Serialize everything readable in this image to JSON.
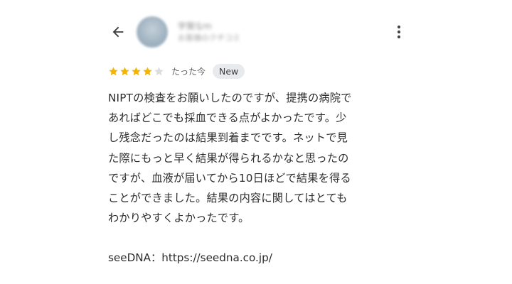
{
  "header": {
    "back_icon": "arrow-left-icon",
    "reviewer_name": "宇賀なm",
    "reviewer_meta": "お客様のクチコミ",
    "more_icon": "more-vert-icon"
  },
  "review": {
    "rating": 4,
    "rating_max": 5,
    "star_filled_color": "#f4b400",
    "star_empty_color": "#dadce0",
    "time": "たった今",
    "badge": "New",
    "text": "NIPTの検査をお願いしたのですが、提携の病院で\nあればどこでも採血できる点がよかったです。少\nし残念だったのは結果到着までです。ネットで見\nた際にもっと早く結果が得られるかなと思ったの\nですが、血液が届いてから10日ほどで結果を得る\nことができました。結果の内容に関してはとても\nわかりやすくよかったです。"
  },
  "footer": {
    "source": "seeDNA：https://seedna.co.jp/"
  }
}
